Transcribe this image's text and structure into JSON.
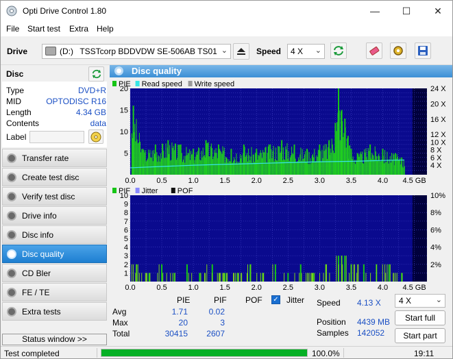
{
  "window": {
    "title": "Opti Drive Control 1.80"
  },
  "menu": {
    "file": "File",
    "start_test": "Start test",
    "extra": "Extra",
    "help": "Help"
  },
  "toolbar": {
    "drive_label": "Drive",
    "drive_letter": "(D:)",
    "drive_name": "TSSTcorp BDDVDW SE-506AB TS01",
    "speed_label": "Speed",
    "speed_value": "4 X"
  },
  "disc": {
    "header": "Disc",
    "rows": [
      {
        "key": "Type",
        "value": "DVD+R"
      },
      {
        "key": "MID",
        "value": "OPTODISC R16"
      },
      {
        "key": "Length",
        "value": "4.34 GB"
      },
      {
        "key": "Contents",
        "value": "data"
      }
    ],
    "label_key": "Label",
    "label_value": ""
  },
  "nav": [
    {
      "label": "Transfer rate",
      "active": false
    },
    {
      "label": "Create test disc",
      "active": false
    },
    {
      "label": "Verify test disc",
      "active": false
    },
    {
      "label": "Drive info",
      "active": false
    },
    {
      "label": "Disc info",
      "active": false
    },
    {
      "label": "Disc quality",
      "active": true
    },
    {
      "label": "CD Bler",
      "active": false
    },
    {
      "label": "FE / TE",
      "active": false
    },
    {
      "label": "Extra tests",
      "active": false
    }
  ],
  "status_window_btn": "Status window >>",
  "panel_title": "Disc quality",
  "chart_data": [
    {
      "type": "bar",
      "legend": [
        "PIE",
        "Read speed",
        "Write speed"
      ],
      "legend_colors": [
        "#16c516",
        "#37e6e6",
        "#9a9a9a"
      ],
      "x_ticks": [
        "0.0",
        "0.5",
        "1.0",
        "1.5",
        "2.0",
        "2.5",
        "3.0",
        "3.5",
        "4.0",
        "4.5 GB"
      ],
      "xlim": [
        0,
        4.7
      ],
      "y_left_ticks": [
        5,
        10,
        15,
        20
      ],
      "ylim_left": [
        0,
        20
      ],
      "y_right_ticks": [
        "4 X",
        "6 X",
        "8 X",
        "10 X",
        "12 X",
        "16 X",
        "20 X",
        "24 X"
      ],
      "disc_end_gb": 4.34,
      "series": [
        {
          "name": "PIE",
          "x": [
            0.05,
            0.2,
            0.4,
            0.6,
            0.8,
            1.0,
            1.2,
            1.4,
            1.6,
            1.8,
            2.0,
            2.2,
            2.4,
            2.6,
            2.8,
            3.0,
            3.15,
            3.25,
            3.3,
            3.35,
            3.4,
            3.45,
            3.5,
            3.6,
            3.8,
            4.0,
            4.2,
            4.3
          ],
          "values": [
            16,
            6,
            7,
            8,
            7,
            6,
            8,
            7,
            6,
            7,
            6,
            7,
            8,
            7,
            6,
            7,
            8,
            12,
            20,
            15,
            13,
            9,
            6,
            5,
            7,
            6,
            5,
            4
          ]
        },
        {
          "name": "Read speed",
          "x": [
            0.0,
            0.5,
            1.0,
            1.5,
            2.0,
            2.5,
            3.0,
            3.5,
            4.0,
            4.34
          ],
          "values": [
            1.6,
            1.9,
            2.2,
            2.4,
            2.6,
            2.8,
            3.0,
            3.1,
            3.3,
            3.4
          ]
        }
      ]
    },
    {
      "type": "bar",
      "legend": [
        "PIF",
        "Jitter",
        "POF"
      ],
      "legend_colors": [
        "#16c516",
        "#8a8aff",
        "#111111"
      ],
      "x_ticks": [
        "0.0",
        "0.5",
        "1.0",
        "1.5",
        "2.0",
        "2.5",
        "3.0",
        "3.5",
        "4.0",
        "4.5 GB"
      ],
      "xlim": [
        0,
        4.7
      ],
      "y_left_ticks": [
        1,
        2,
        3,
        4,
        5,
        6,
        7,
        8,
        9,
        10
      ],
      "ylim_left": [
        0,
        10
      ],
      "y_right_ticks": [
        "2%",
        "4%",
        "6%",
        "8%",
        "10%"
      ],
      "disc_end_gb": 4.34,
      "series": [
        {
          "name": "PIF",
          "x": [
            0.1,
            0.3,
            0.5,
            0.7,
            0.9,
            1.1,
            1.3,
            1.5,
            1.7,
            1.9,
            2.1,
            2.3,
            2.5,
            2.7,
            2.9,
            3.1,
            3.3,
            3.35,
            3.4,
            3.5,
            3.7,
            3.9,
            4.1,
            4.3
          ],
          "values": [
            2,
            1,
            2,
            1,
            2,
            1,
            2,
            1,
            1,
            2,
            1,
            2,
            1,
            2,
            1,
            2,
            3,
            3,
            3,
            2,
            2,
            2,
            2,
            1
          ]
        }
      ]
    }
  ],
  "stats": {
    "col_pie": "PIE",
    "col_pif": "PIF",
    "col_pof": "POF",
    "jitter_label": "Jitter",
    "jitter_checked": true,
    "avg_label": "Avg",
    "max_label": "Max",
    "total_label": "Total",
    "pie_avg": "1.71",
    "pie_max": "20",
    "pie_total": "30415",
    "pif_avg": "0.02",
    "pif_max": "3",
    "pif_total": "2607",
    "speed_label": "Speed",
    "speed_value": "4.13 X",
    "position_label": "Position",
    "position_value": "4439 MB",
    "samples_label": "Samples",
    "samples_value": "142052",
    "speed_select": "4 X",
    "start_full": "Start full",
    "start_part": "Start part"
  },
  "statusbar": {
    "text": "Test completed",
    "progress": 1.0,
    "percent": "100.0%",
    "time": "19:11"
  }
}
